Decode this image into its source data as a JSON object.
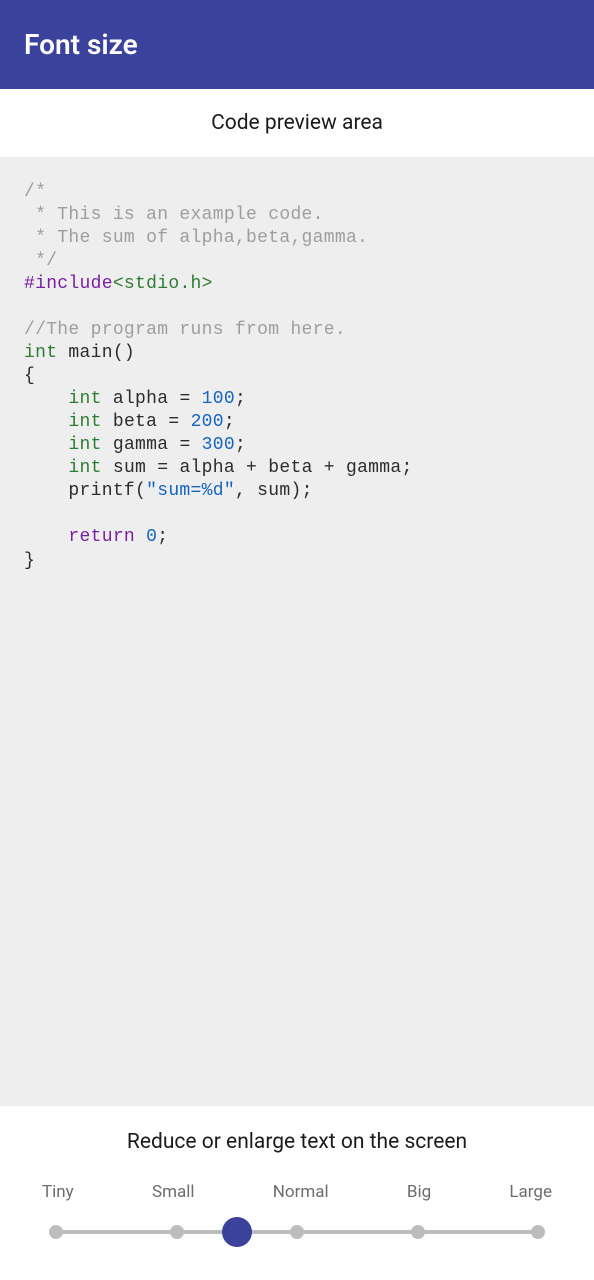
{
  "header": {
    "title": "Font size"
  },
  "preview": {
    "label": "Code preview area",
    "code": {
      "comment_block": {
        "l1": "/*",
        "l2": " * This is an example code.",
        "l3": " * The sum of alpha,beta,gamma.",
        "l4": " */"
      },
      "include_directive": "#include",
      "include_header": "<stdio.h>",
      "line_comment": "//The program runs from here.",
      "kw_int": "int",
      "main_sig": " main()",
      "brace_open": "{",
      "decl_alpha_pre": " alpha = ",
      "decl_alpha_val": "100",
      "decl_beta_pre": " beta = ",
      "decl_beta_val": "200",
      "decl_gamma_pre": " gamma = ",
      "decl_gamma_val": "300",
      "decl_sum": " sum = alpha + beta + gamma;",
      "printf_call_a": "    printf(",
      "printf_string": "\"sum=%d\"",
      "printf_call_b": ", sum);",
      "kw_return": "return",
      "return_val": "0",
      "semicolon": ";",
      "brace_close": "}"
    }
  },
  "footer": {
    "instruction": "Reduce or enlarge text on the screen",
    "slider": {
      "options": {
        "o0": "Tiny",
        "o1": "Small",
        "o2": "Normal",
        "o3": "Big",
        "o4": "Large"
      },
      "selected_index": 2
    }
  }
}
